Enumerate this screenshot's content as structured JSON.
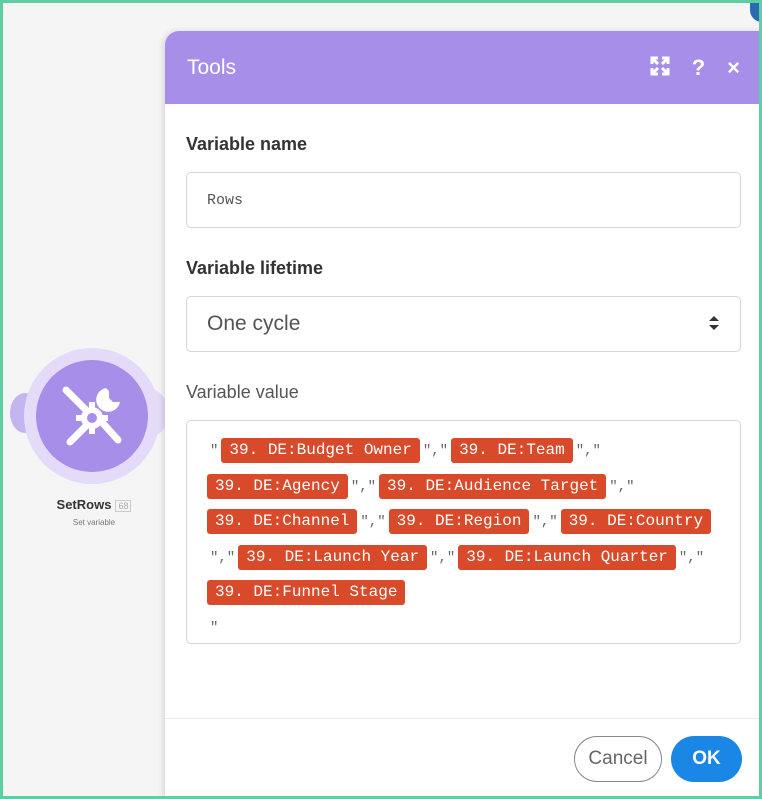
{
  "module": {
    "name": "SetRows",
    "badge": "68",
    "subtitle": "Set variable",
    "icon": "tools-icon"
  },
  "dialog": {
    "title": "Tools",
    "header_icons": [
      "expand-icon",
      "help-icon",
      "close-icon"
    ],
    "header_labels": {
      "help": "?",
      "close": "×"
    }
  },
  "fields": {
    "variable_name_label": "Variable name",
    "variable_name_value": "Rows",
    "variable_lifetime_label": "Variable lifetime",
    "variable_lifetime_value": "One cycle",
    "variable_value_label": "Variable value"
  },
  "value_tokens": {
    "open_quote": "\"",
    "separator": "\",\"",
    "close_quote": "\"",
    "pills": [
      "39. DE:Budget Owner",
      "39. DE:Team",
      "39. DE:Agency",
      "39. DE:Audience Target",
      "39. DE:Channel",
      "39. DE:Region",
      "39. DE:Country",
      "39. DE:Launch Year",
      "39. DE:Launch Quarter",
      "39. DE:Funnel Stage"
    ]
  },
  "footer": {
    "cancel_label": "Cancel",
    "ok_label": "OK"
  },
  "colors": {
    "header": "#a78ee8",
    "pill": "#d84a2a",
    "ok": "#1a86e6",
    "frame": "#5fcfa3"
  }
}
